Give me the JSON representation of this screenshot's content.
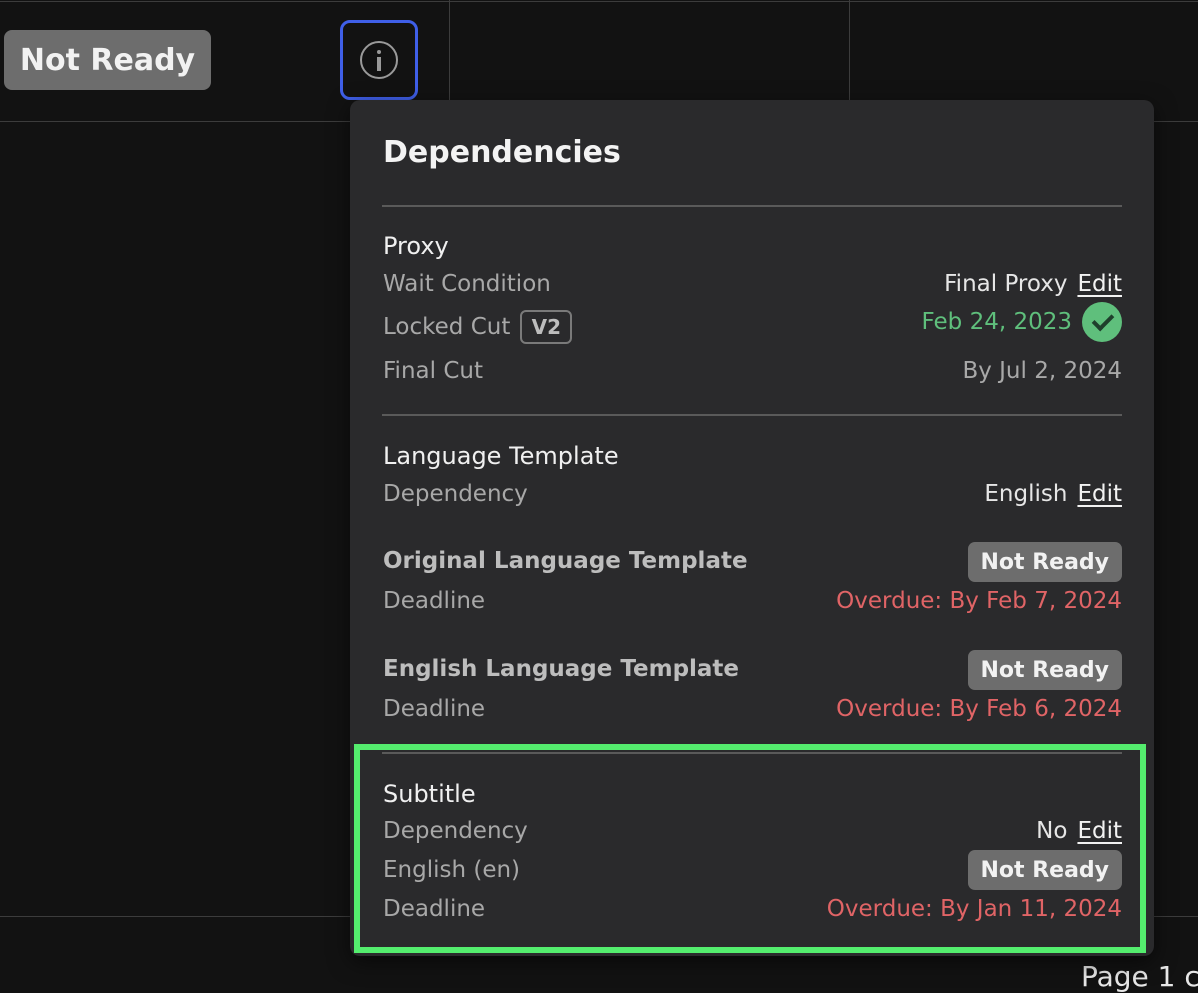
{
  "background_row": {
    "status_label": "Not Ready",
    "page_label": "Page 1 c"
  },
  "popover": {
    "title": "Dependencies",
    "proxy": {
      "section_title": "Proxy",
      "wait_condition_label": "Wait Condition",
      "wait_condition_value": "Final Proxy",
      "wait_condition_edit": "Edit",
      "locked_cut_label": "Locked Cut",
      "locked_cut_version": "V2",
      "locked_cut_date": "Feb 24, 2023",
      "final_cut_label": "Final Cut",
      "final_cut_value": "By Jul 2, 2024"
    },
    "language_template": {
      "section_title": "Language Template",
      "dependency_label": "Dependency",
      "dependency_value": "English",
      "dependency_edit": "Edit",
      "items": [
        {
          "name": "Original Language Template",
          "status": "Not Ready",
          "deadline_label": "Deadline",
          "deadline_value": "Overdue: By Feb 7, 2024"
        },
        {
          "name": "English Language Template",
          "status": "Not Ready",
          "deadline_label": "Deadline",
          "deadline_value": "Overdue: By Feb 6, 2024"
        }
      ]
    },
    "subtitle": {
      "section_title": "Subtitle",
      "dependency_label": "Dependency",
      "dependency_value": "No",
      "dependency_edit": "Edit",
      "language_label": "English (en)",
      "language_status": "Not Ready",
      "deadline_label": "Deadline",
      "deadline_value": "Overdue: By Jan 11, 2024"
    }
  },
  "colors": {
    "background": "#121212",
    "popover_background": "#2a2a2c",
    "info_button_border": "#3f5fe8",
    "success": "#5fbf7c",
    "overdue": "#e06466",
    "status_badge": "#6d6d6d",
    "highlight": "#54ed6e"
  },
  "icons": {
    "info": "info-icon",
    "check": "check-circle-icon"
  }
}
